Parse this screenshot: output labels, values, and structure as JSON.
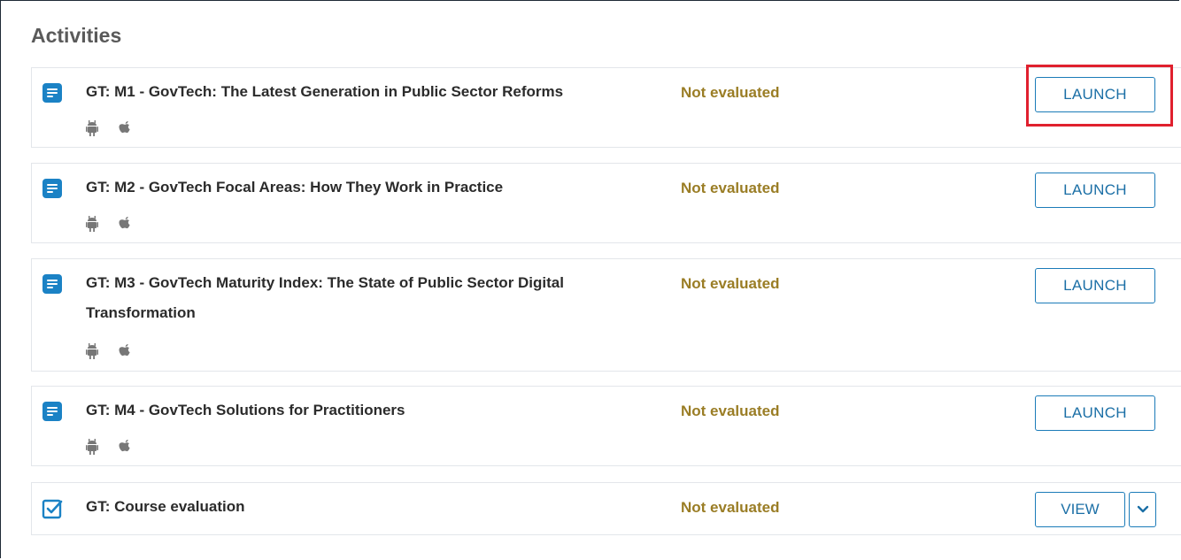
{
  "section_title": "Activities",
  "colors": {
    "accent": "#1b82c5",
    "status": "#9a7d25",
    "highlight": "#e0202e"
  },
  "activities": [
    {
      "icon": "document-icon",
      "title": "GT: M1 - GovTech: The Latest Generation in Public Sector Reforms",
      "status": "Not evaluated",
      "platforms": [
        "android-icon",
        "apple-icon"
      ],
      "button": "LAUNCH"
    },
    {
      "icon": "document-icon",
      "title": "GT: M2 - GovTech Focal Areas: How They Work in Practice",
      "status": "Not evaluated",
      "platforms": [
        "android-icon",
        "apple-icon"
      ],
      "button": "LAUNCH"
    },
    {
      "icon": "document-icon",
      "title": "GT: M3 - GovTech Maturity Index: The State of Public Sector Digital Transformation",
      "status": "Not evaluated",
      "platforms": [
        "android-icon",
        "apple-icon"
      ],
      "button": "LAUNCH"
    },
    {
      "icon": "document-icon",
      "title": "GT: M4 - GovTech Solutions for Practitioners",
      "status": "Not evaluated",
      "platforms": [
        "android-icon",
        "apple-icon"
      ],
      "button": "LAUNCH"
    },
    {
      "icon": "checkbox-icon",
      "title": "GT: Course evaluation",
      "status": "Not evaluated",
      "button": "VIEW",
      "dropdown": "chevron-down-icon"
    }
  ]
}
